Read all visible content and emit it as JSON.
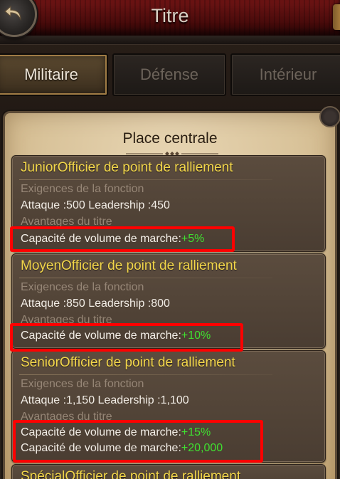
{
  "header": {
    "title": "Titre"
  },
  "tabs": [
    {
      "label": "Militaire",
      "active": true
    },
    {
      "label": "Défense",
      "active": false
    },
    {
      "label": "Intérieur",
      "active": false
    }
  ],
  "panel": {
    "title": "Place centrale"
  },
  "ranks": [
    {
      "title": "JuniorOfficier de point de ralliement",
      "requirements_label": "Exigences de la fonction",
      "requirements": "Attaque :500 Leadership :450",
      "benefits_label": "Avantages du titre",
      "benefits": [
        {
          "label": "Capacité de volume de marche:",
          "value": "+5%"
        }
      ]
    },
    {
      "title": "MoyenOfficier de point de ralliement",
      "requirements_label": "Exigences de la fonction",
      "requirements": "Attaque :850 Leadership :800",
      "benefits_label": "Avantages du titre",
      "benefits": [
        {
          "label": "Capacité de volume de marche:",
          "value": "+10%"
        }
      ]
    },
    {
      "title": "SeniorOfficier de point de ralliement",
      "requirements_label": "Exigences de la fonction",
      "requirements": "Attaque :1,150 Leadership :1,100",
      "benefits_label": "Avantages du titre",
      "benefits": [
        {
          "label": "Capacité de volume de marche:",
          "value": "+15%"
        },
        {
          "label": "Capacité de volume de marche:",
          "value": "+20,000"
        }
      ]
    },
    {
      "title": "SpécialOfficier de point de ralliement"
    }
  ],
  "colors": {
    "rank_title": "#f2d64a",
    "bonus_value": "#3fe030",
    "highlight_box": "#ff0000",
    "active_tab_border": "#a07c45"
  },
  "icons": {
    "back": "back-arrow-icon",
    "ornament": "ornament-divider-icon"
  }
}
